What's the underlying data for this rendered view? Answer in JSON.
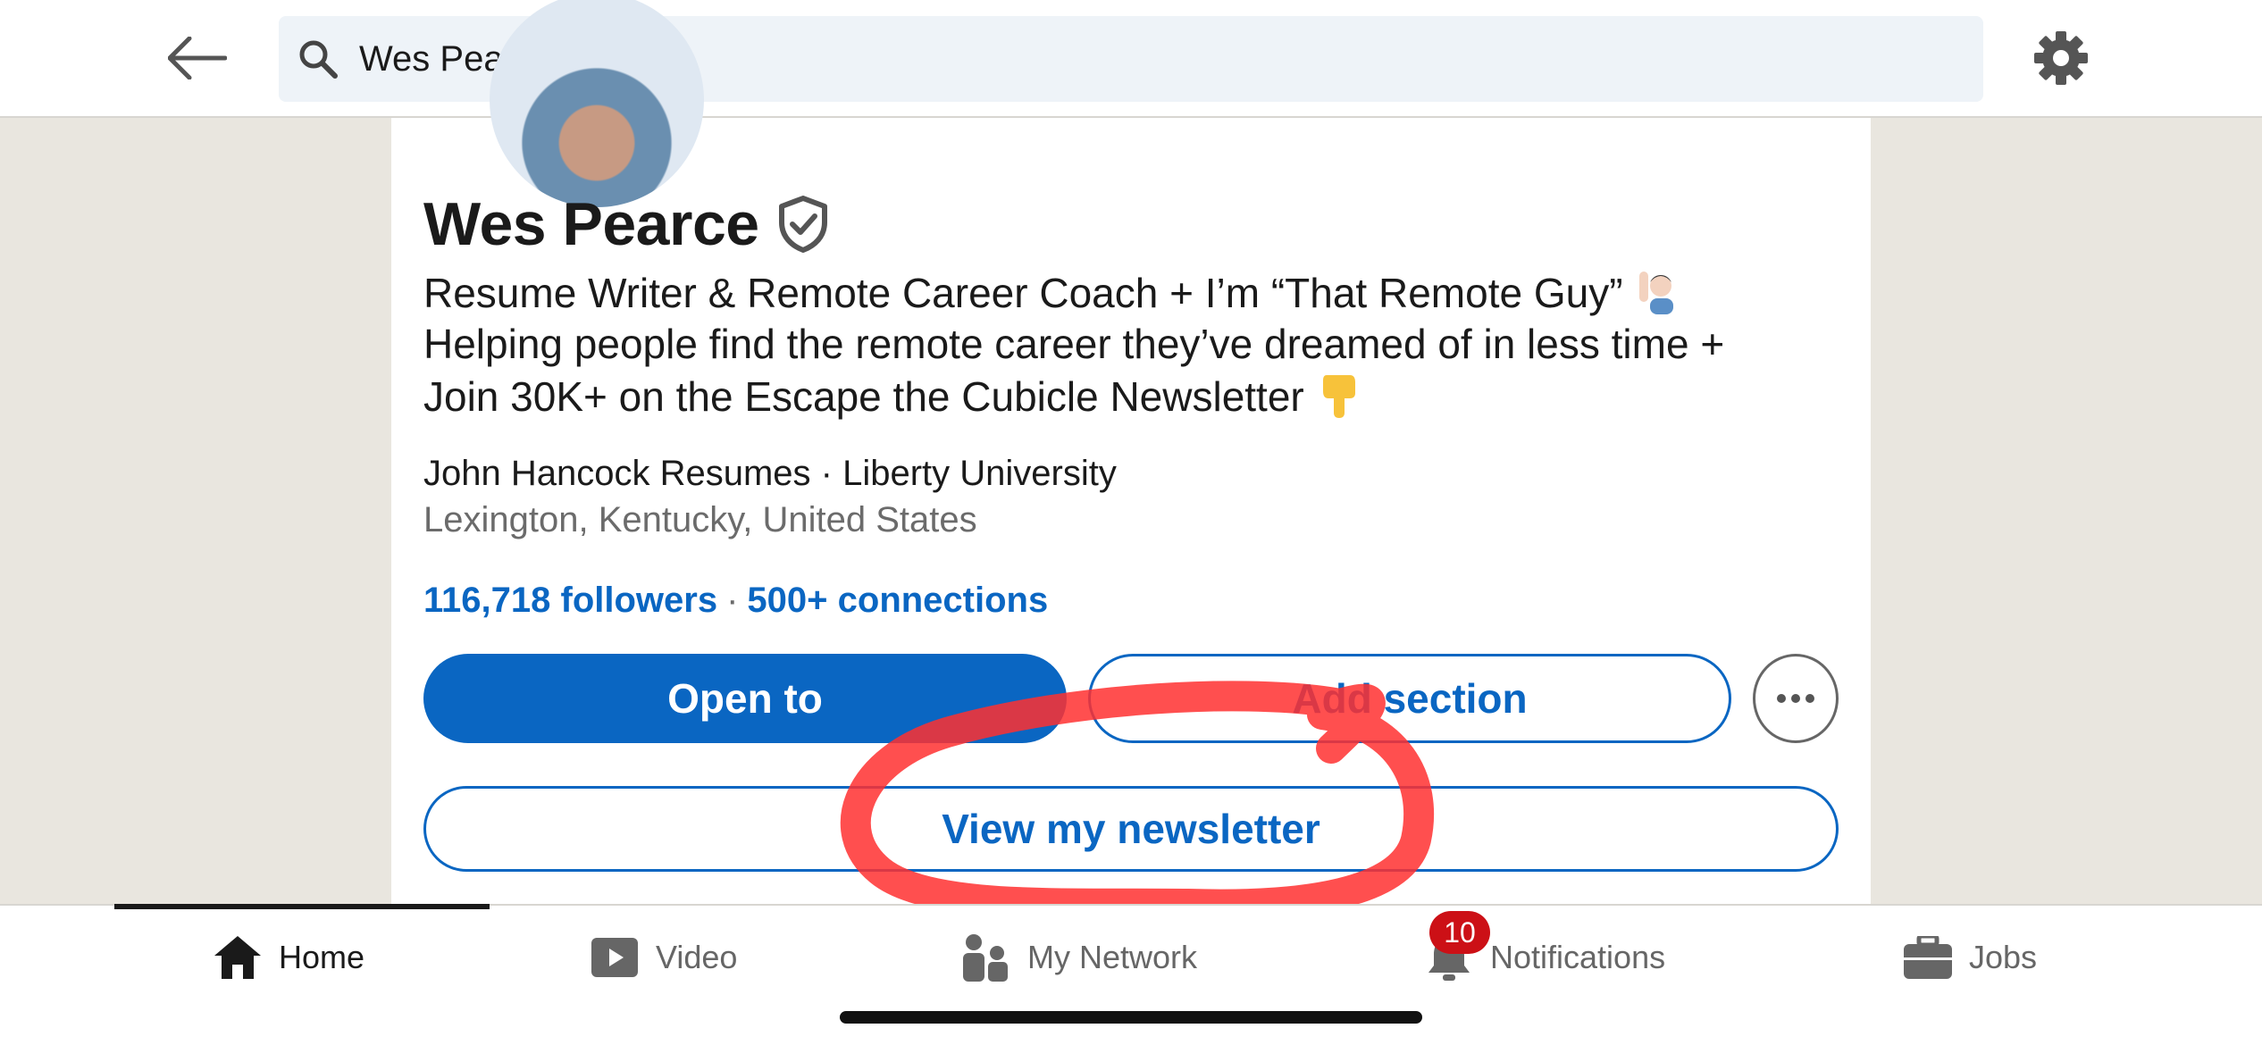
{
  "search": {
    "value": "Wes Pearce"
  },
  "icons": {
    "back": "arrow-left-icon",
    "search": "search-icon",
    "settings": "gear-icon",
    "verified": "verified-shield-icon",
    "more": "more-horizontal-icon"
  },
  "profile": {
    "name": "Wes Pearce",
    "headline_line1": "Resume Writer & Remote Career Coach + I’m “That Remote Guy”",
    "headline_line2": "Helping people find the remote career they’ve dreamed of in less time +",
    "headline_line3": "Join 30K+ on the Escape the Cubicle Newsletter",
    "company_education": "John Hancock Resumes · Liberty University",
    "location": "Lexington, Kentucky, United States",
    "followers": "116,718 followers",
    "separator": "·",
    "connections": "500+ connections"
  },
  "actions": {
    "open_to": "Open to",
    "add_section": "Add section",
    "view_newsletter": "View my newsletter"
  },
  "bottom_nav": {
    "items": [
      {
        "label": "Home",
        "icon": "home-icon",
        "active": true
      },
      {
        "label": "Video",
        "icon": "video-play-icon",
        "active": false
      },
      {
        "label": "My Network",
        "icon": "people-icon",
        "active": false
      },
      {
        "label": "Notifications",
        "icon": "bell-icon",
        "active": false,
        "badge": "10"
      },
      {
        "label": "Jobs",
        "icon": "briefcase-icon",
        "active": false
      }
    ]
  },
  "colors": {
    "brand_blue": "#0a66c2",
    "badge_red": "#cc1016",
    "annotation_red": "#ff3030",
    "gutter": "#e9e6df"
  }
}
